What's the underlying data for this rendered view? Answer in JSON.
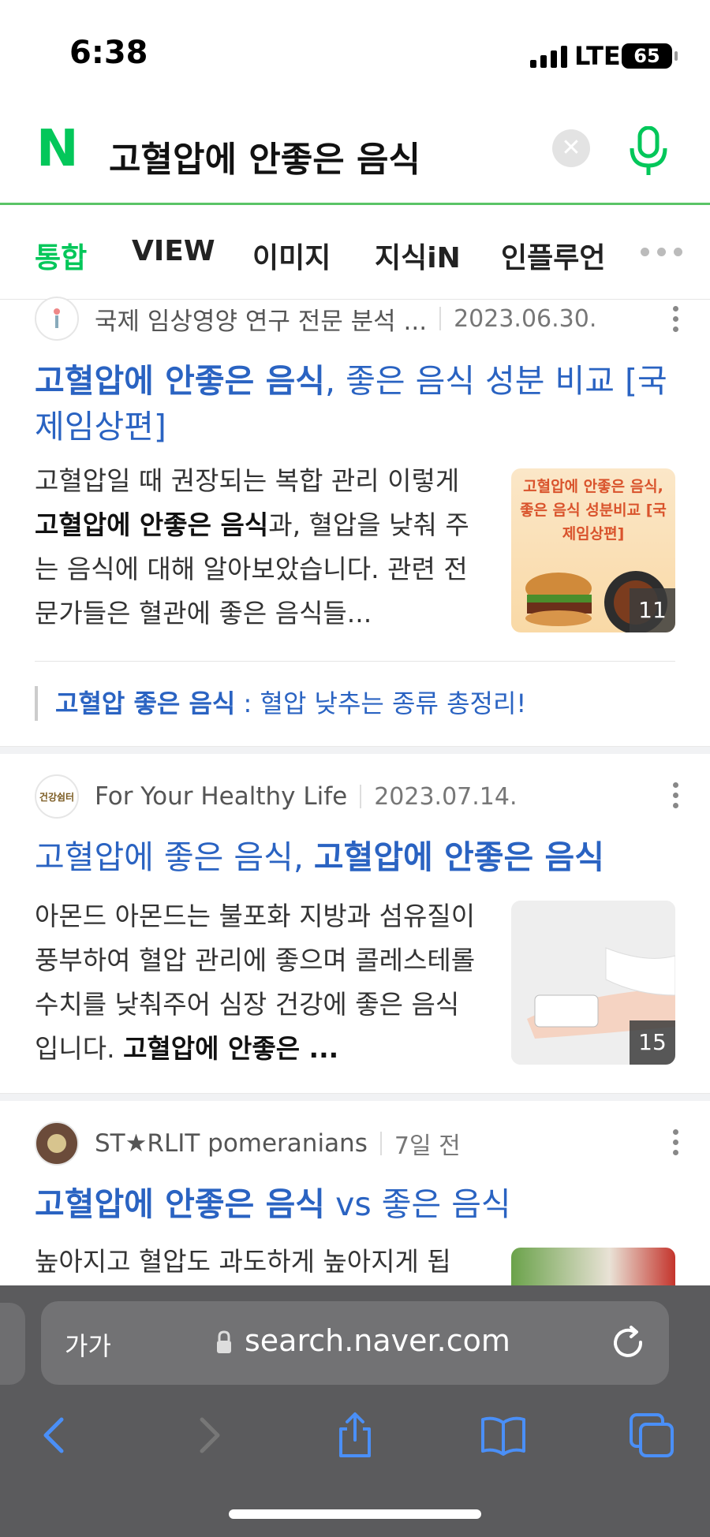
{
  "status_bar": {
    "time": "6:38",
    "network": "LTE",
    "battery": "65"
  },
  "search": {
    "logo": "N",
    "query": "고혈압에 안좋은 음식",
    "clear_icon": "close-icon",
    "mic_icon": "microphone-icon"
  },
  "tabs": [
    {
      "label": "통합",
      "active": true
    },
    {
      "label": "VIEW"
    },
    {
      "label": "이미지"
    },
    {
      "label": "지식iN"
    },
    {
      "label": "인플루언"
    }
  ],
  "results": [
    {
      "source": "국제 임상영양 연구 전문 분석 ...",
      "date": "2023.06.30.",
      "title_bold": "고혈압에 안좋은 음식",
      "title_rest": ", 좋은 음식 성분 비교 [국제임상편]",
      "desc_1": "고혈압일 때 권장되는 복합 관리 이렇게 ",
      "desc_bold": "고혈압에 안좋은 음식",
      "desc_2": "과, 혈압을 낮춰 주는 음식에 대해 알아보았습니다. 관련 전문가들은 혈관에 좋은 음식들...",
      "thumb_text": "고혈압에 안좋은 음식, 좋은 음식 성분비교 [국제임상편]",
      "thumb_count": "11",
      "related_bold": "고혈압 좋은 음식",
      "related_rest": " : 혈압 낮추는 종류 총정리!"
    },
    {
      "source": "For Your Healthy Life",
      "logo_text": "건강쉼터",
      "date": "2023.07.14.",
      "title_plain": "고혈압에 좋은 음식, ",
      "title_bold": "고혈압에 안좋은 음식",
      "desc_1": "아몬드 아몬드는 불포화 지방과 섬유질이 풍부하여 혈압 관리에 좋으며 콜레스테롤 수치를 낮춰주어 심장 건강에 좋은 음식입니다. ",
      "desc_bold": "고혈압에 안좋은 ...",
      "thumb_count": "15"
    },
    {
      "source": "ST★RLIT pomeranians",
      "date": "7일 전",
      "title_bold": "고혈압에 안좋은 음식",
      "title_rest": " vs 좋은 음식",
      "desc_1": "높아지고 혈압도 과도하게 높아지게 됩"
    }
  ],
  "browser": {
    "text_size": "가가",
    "url": "search.naver.com"
  },
  "colors": {
    "naver_green": "#03c75a",
    "link_blue": "#2a63c2"
  }
}
